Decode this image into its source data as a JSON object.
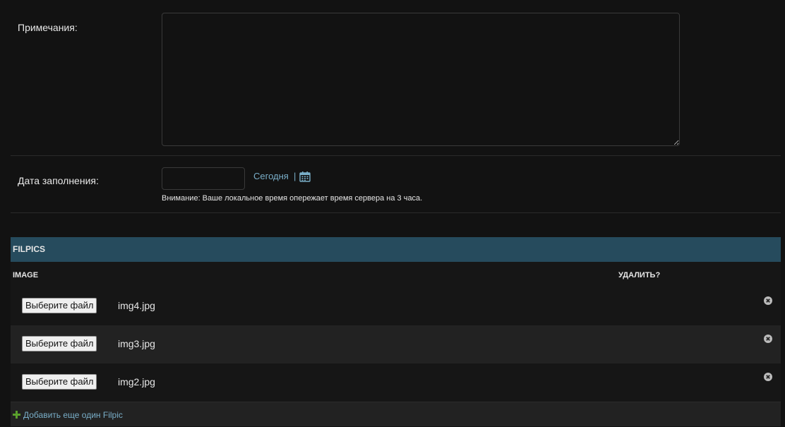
{
  "notes": {
    "label": "Примечания:",
    "value": ""
  },
  "fill_date": {
    "label": "Дата заполнения:",
    "value": "",
    "today_link": "Сегодня",
    "separator": "|",
    "calendar_icon": "calendar-icon",
    "warning": "Внимание: Ваше локальное время опережает время сервера на 3 часа."
  },
  "inline": {
    "title": "FILPICS",
    "columns": {
      "image": "IMAGE",
      "delete": "УДАЛИТЬ?"
    },
    "choose_label": "Выберите файл",
    "rows": [
      {
        "file": "img4.jpg"
      },
      {
        "file": "img3.jpg"
      },
      {
        "file": "img2.jpg"
      }
    ],
    "add_link": "Добавить еще один Filpic"
  },
  "colors": {
    "inline_header_bg": "#264b5d",
    "link": "#79aec8",
    "add_icon": "#5aa02c",
    "background": "#121212"
  }
}
